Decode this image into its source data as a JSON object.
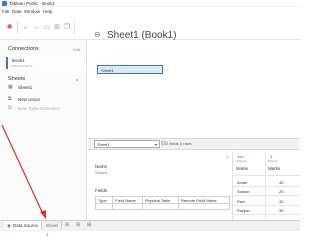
{
  "window": {
    "title": "Tableau Public - Book1"
  },
  "menu": [
    "File",
    "Data",
    "Window",
    "Help"
  ],
  "toolbar": {
    "logo": "tableau-logo-icon",
    "back": "←",
    "forward": "→",
    "save": "save-icon",
    "add": "add-datasource-icon",
    "copy": "copy-icon"
  },
  "header": {
    "sheet_title": "Sheet1 (Book1)"
  },
  "sidebar": {
    "connections_title": "Connections",
    "connections_action": "Add",
    "connection": {
      "name": "Book1",
      "subtitle": "Microsoft Excel"
    },
    "sheets_title": "Sheets",
    "sheets_action": "ρ",
    "sheets": [
      {
        "label": "Sheet1",
        "icon": "table-icon",
        "dim": false
      },
      {
        "label": "New Union",
        "icon": "union-icon",
        "dim": false
      },
      {
        "label": "New Table Extension",
        "icon": "extension-icon",
        "dim": true
      }
    ]
  },
  "canvas": {
    "table_pill": "Sheet1"
  },
  "grid_toolbar": {
    "selected_sheet": "Sheet1",
    "fields_rows": "2 fields 5 rows"
  },
  "metadata": {
    "name_label": "Name",
    "name_value": "Sheet1",
    "fields_label": "Fields",
    "columns": [
      "Type",
      "Field Name",
      "Physical Table",
      "Remote Field Name"
    ]
  },
  "data_grid": {
    "columns": [
      {
        "type": "Abc",
        "source": "Sheet1",
        "name": "Name"
      },
      {
        "type": "#",
        "source": "Sheet1",
        "name": "Marks"
      }
    ],
    "rows": [
      [
        "Aman",
        "45"
      ],
      [
        "Suman",
        "25"
      ],
      [
        "Ravi",
        "32"
      ],
      [
        "Ranjan",
        "35"
      ]
    ]
  },
  "tabs": {
    "data_source": "Data Source",
    "sheet": "Sheet 1"
  },
  "colors": {
    "accent": "#3b78b6",
    "arrow": "#d8302a"
  }
}
